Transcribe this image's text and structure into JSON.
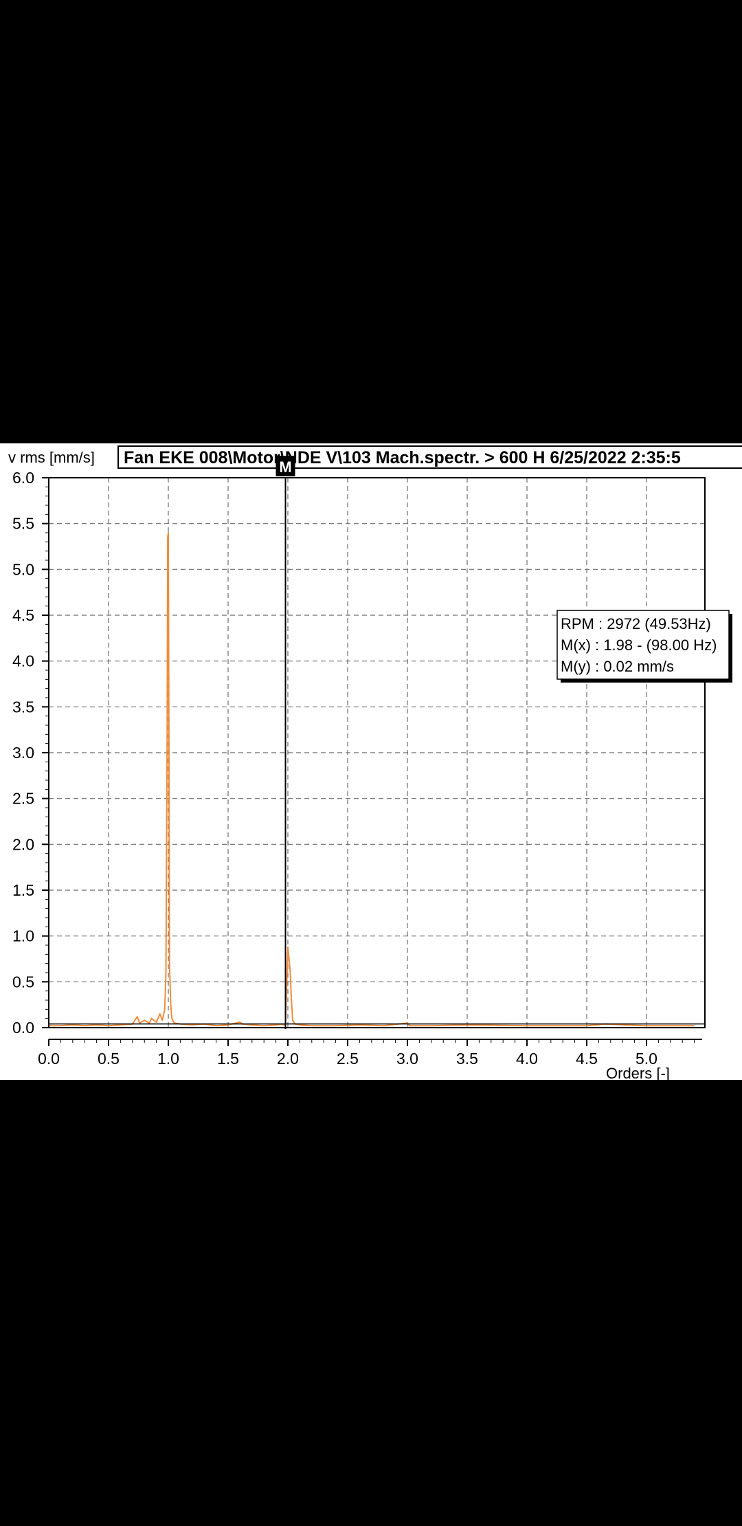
{
  "colors": {
    "background": "#000000",
    "plot_bg": "#ffffff",
    "series": "#f28c3a",
    "grid": "#6b6b6b",
    "axis": "#000000",
    "marker": "#000000"
  },
  "title": "Fan EKE 008\\Motor\\NDE V\\103 Mach.spectr. > 600 H 6/25/2022 2:35:5",
  "marker_label": "M",
  "info": {
    "rpm": "RPM : 2972 (49.53Hz)",
    "mx": "M(x) : 1.98 - (98.00 Hz)",
    "my": "M(y) : 0.02 mm/s"
  },
  "chart_data": {
    "type": "line",
    "title": "Fan EKE 008\\Motor\\NDE V\\103 Mach.spectr. > 600 H 6/25/2022 2:35:5",
    "ylabel": "v rms [mm/s]",
    "xlabel": "Orders [-]",
    "xlim": [
      0.0,
      5.4
    ],
    "ylim": [
      0.0,
      6.0
    ],
    "xticks": [
      "0.0",
      "0.5",
      "1.0",
      "1.5",
      "2.0",
      "2.5",
      "3.0",
      "3.5",
      "4.0",
      "4.5",
      "5.0"
    ],
    "yticks": [
      "0.0",
      "0.5",
      "1.0",
      "1.5",
      "2.0",
      "2.5",
      "3.0",
      "3.5",
      "4.0",
      "4.5",
      "5.0",
      "5.5",
      "6.0"
    ],
    "grid": true,
    "marker_x": 1.98,
    "series": [
      {
        "x": [
          0.0,
          0.1,
          0.2,
          0.3,
          0.4,
          0.5,
          0.6,
          0.7,
          0.74,
          0.76,
          0.8,
          0.84,
          0.86,
          0.9,
          0.93,
          0.95,
          0.97,
          0.98,
          0.99,
          0.995,
          1.0,
          1.005,
          1.01,
          1.02,
          1.03,
          1.05,
          1.1,
          1.2,
          1.3,
          1.35,
          1.4,
          1.5,
          1.6,
          1.62,
          1.7,
          1.8,
          1.9,
          1.95,
          1.98,
          2.0,
          2.01,
          2.02,
          2.03,
          2.04,
          2.06,
          2.1,
          2.2,
          2.4,
          2.6,
          2.8,
          3.0,
          3.02,
          3.2,
          3.5,
          4.0,
          4.5,
          4.65,
          5.0,
          5.4
        ],
        "y": [
          0.02,
          0.02,
          0.03,
          0.02,
          0.03,
          0.02,
          0.03,
          0.04,
          0.12,
          0.05,
          0.08,
          0.05,
          0.1,
          0.06,
          0.15,
          0.08,
          0.2,
          0.6,
          3.25,
          5.35,
          5.4,
          3.2,
          0.7,
          0.25,
          0.1,
          0.05,
          0.04,
          0.03,
          0.04,
          0.03,
          0.02,
          0.03,
          0.06,
          0.04,
          0.03,
          0.02,
          0.03,
          0.04,
          0.02,
          0.88,
          0.75,
          0.6,
          0.3,
          0.08,
          0.04,
          0.03,
          0.02,
          0.02,
          0.03,
          0.02,
          0.05,
          0.02,
          0.02,
          0.03,
          0.02,
          0.02,
          0.04,
          0.02,
          0.02
        ]
      }
    ]
  }
}
